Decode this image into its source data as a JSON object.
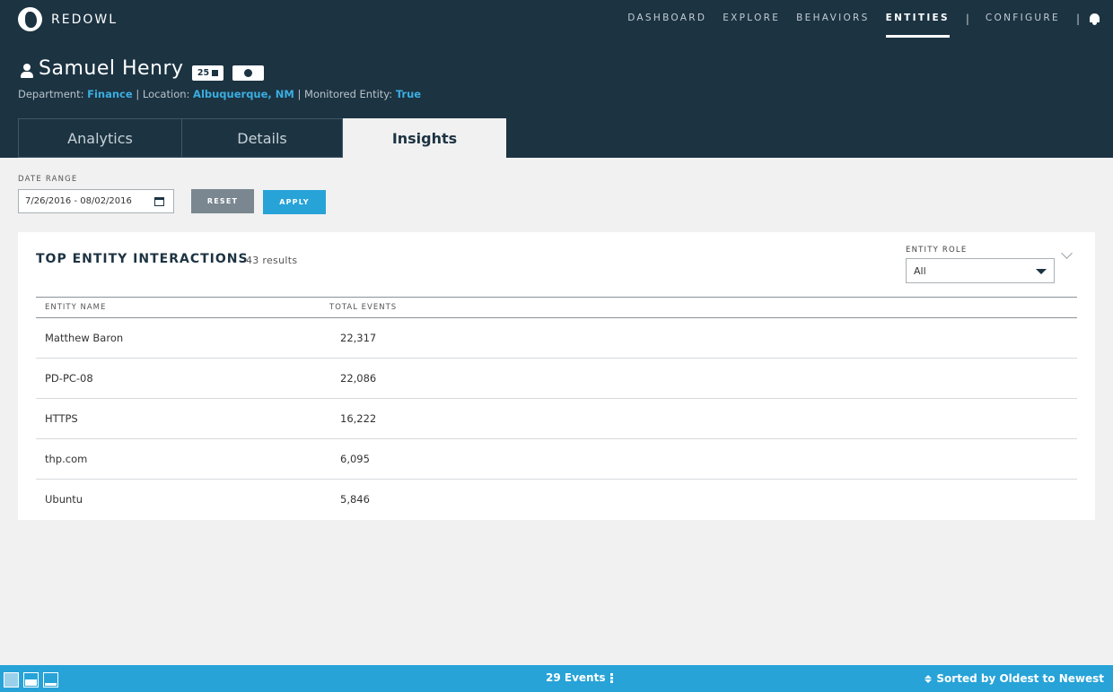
{
  "app": {
    "brand": "REDOWL"
  },
  "nav": {
    "items": [
      {
        "label": "DASHBOARD"
      },
      {
        "label": "EXPLORE"
      },
      {
        "label": "BEHAVIORS"
      },
      {
        "label": "ENTITIES"
      },
      {
        "label": "CONFIGURE"
      }
    ],
    "separator": "|",
    "active": "ENTITIES"
  },
  "entity": {
    "name": "Samuel Henry",
    "badge_count": "25",
    "department_label": "Department:",
    "department": "Finance",
    "location_label": "| Location:",
    "location": "Albuquerque, NM",
    "monitored_label": "| Monitored Entity:",
    "monitored": "True"
  },
  "tabs": [
    {
      "label": "Analytics"
    },
    {
      "label": "Details"
    },
    {
      "label": "Insights"
    }
  ],
  "date_range": {
    "label": "DATE RANGE",
    "value": "7/26/2016 - 08/02/2016",
    "reset_label": "RESET",
    "apply_label": "APPLY"
  },
  "panel": {
    "title": "TOP ENTITY INTERACTIONS",
    "results": "43 results",
    "role_label": "ENTITY ROLE",
    "role_value": "All",
    "columns": [
      "ENTITY NAME",
      "TOTAL EVENTS"
    ],
    "rows": [
      {
        "name": "Matthew Baron",
        "events": "22,317"
      },
      {
        "name": "PD-PC-08",
        "events": "22,086"
      },
      {
        "name": "HTTPS",
        "events": "16,222"
      },
      {
        "name": "thp.com",
        "events": "6,095"
      },
      {
        "name": "Ubuntu",
        "events": "5,846"
      }
    ]
  },
  "footer": {
    "events": "29 Events",
    "sorted": "Sorted by Oldest to Newest"
  },
  "colors": {
    "header_bg": "#1c3342",
    "accent": "#27a3d8",
    "link": "#3aaee0"
  }
}
